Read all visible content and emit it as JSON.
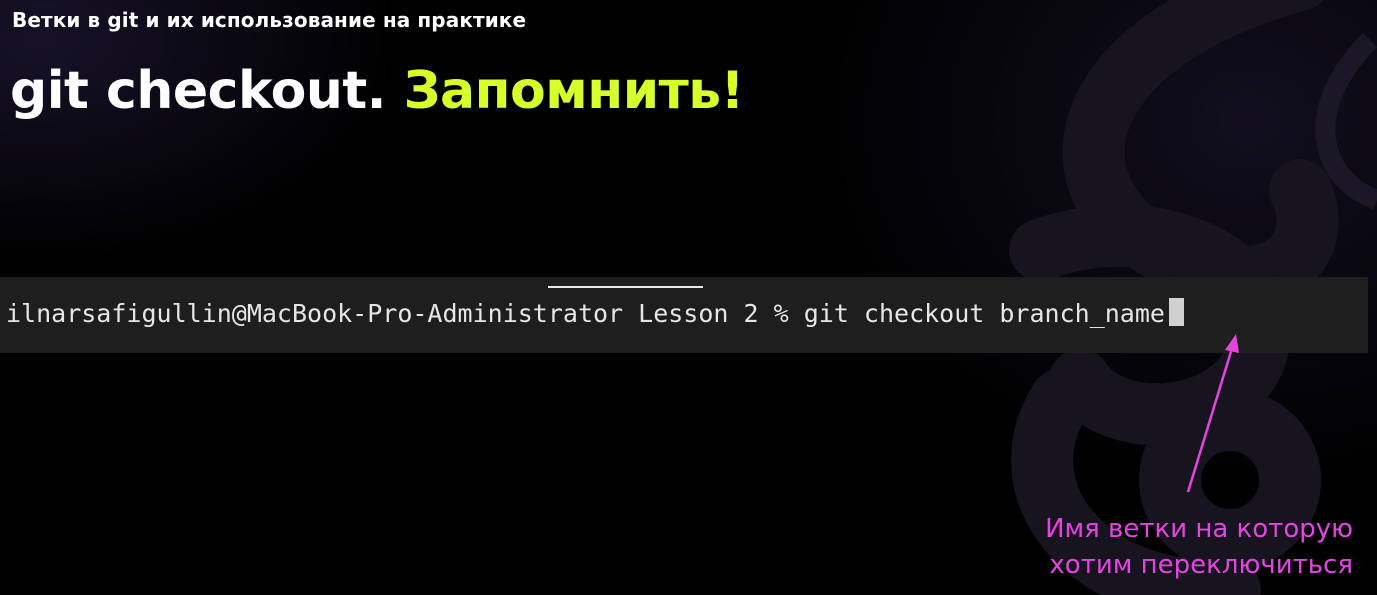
{
  "slide": {
    "subtitle": "Ветки в git и их использование на практике",
    "title_main": "git checkout.",
    "title_accent": "Запомнить!",
    "accent_color": "#d7ff2a"
  },
  "terminal": {
    "command_line": "ilnarsafigullin@MacBook-Pro-Administrator Lesson 2 % git checkout branch_name",
    "cursor": "block-cursor"
  },
  "annotation": {
    "line1": "Имя ветки на которую",
    "line2": "хотим переключиться",
    "color": "#e245e0"
  },
  "icons": [
    "background-logo-icon",
    "arrow-icon"
  ]
}
